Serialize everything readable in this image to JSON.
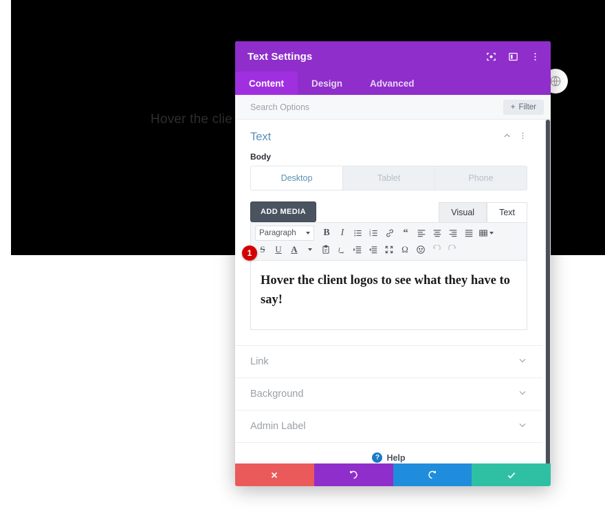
{
  "page_background": {
    "hero_text": "Hover the clie",
    "dark_color": "#000000",
    "globe_button_icon": "globe-icon"
  },
  "modal": {
    "title": "Text Settings",
    "header_icons": [
      {
        "name": "focus-target-icon"
      },
      {
        "name": "layout-panel-icon"
      },
      {
        "name": "more-vertical-icon"
      }
    ],
    "tabs": [
      {
        "label": "Content",
        "active": true
      },
      {
        "label": "Design",
        "active": false
      },
      {
        "label": "Advanced",
        "active": false
      }
    ],
    "search": {
      "placeholder": "Search Options",
      "value": "",
      "filter_label": "Filter"
    },
    "section": {
      "title": "Text",
      "collapse_icon": "chevron-up-icon",
      "menu_icon": "more-vertical-icon"
    },
    "body_field": {
      "label": "Body",
      "device_tabs": [
        {
          "label": "Desktop",
          "active": true
        },
        {
          "label": "Tablet",
          "active": false
        },
        {
          "label": "Phone",
          "active": false
        }
      ],
      "add_media_label": "ADD MEDIA",
      "editor_modes": [
        {
          "label": "Visual",
          "active": false
        },
        {
          "label": "Text",
          "active": true
        }
      ],
      "toolbar_row1": [
        {
          "name": "paragraph-format-select",
          "label": "Paragraph",
          "type": "select"
        },
        {
          "name": "bold-icon",
          "glyph": "B",
          "type": "bold"
        },
        {
          "name": "italic-icon",
          "glyph": "I",
          "type": "italic"
        },
        {
          "name": "bullet-list-icon",
          "type": "ul"
        },
        {
          "name": "numbered-list-icon",
          "type": "ol"
        },
        {
          "name": "link-icon",
          "type": "link"
        },
        {
          "name": "blockquote-icon",
          "glyph": "“",
          "type": "quote"
        },
        {
          "name": "align-left-icon",
          "type": "align-left"
        },
        {
          "name": "align-center-icon",
          "type": "align-center"
        },
        {
          "name": "align-right-icon",
          "type": "align-right"
        },
        {
          "name": "align-justify-icon",
          "type": "align-justify"
        },
        {
          "name": "table-icon",
          "type": "table"
        }
      ],
      "toolbar_row2": [
        {
          "name": "strikethrough-icon",
          "glyph": "S",
          "type": "strike"
        },
        {
          "name": "underline-icon",
          "glyph": "U",
          "type": "underline"
        },
        {
          "name": "text-color-icon",
          "glyph": "A",
          "type": "textcolor"
        },
        {
          "name": "paste-as-text-icon",
          "type": "paste"
        },
        {
          "name": "clear-formatting-icon",
          "glyph": "I",
          "type": "clearfmt"
        },
        {
          "name": "indent-icon",
          "type": "indent"
        },
        {
          "name": "outdent-icon",
          "type": "outdent"
        },
        {
          "name": "fullscreen-icon",
          "type": "fullscreen"
        },
        {
          "name": "special-character-icon",
          "glyph": "Ω",
          "type": "omega"
        },
        {
          "name": "emoji-icon",
          "type": "emoji"
        },
        {
          "name": "undo-icon",
          "type": "undo",
          "disabled": true
        },
        {
          "name": "redo-icon",
          "type": "redo",
          "disabled": true
        }
      ],
      "content_text": "Hover the client logos to see what they have to say!"
    },
    "accordions": [
      {
        "label": "Link"
      },
      {
        "label": "Background"
      },
      {
        "label": "Admin Label"
      }
    ],
    "help": {
      "label": "Help",
      "icon_glyph": "?"
    },
    "footer_buttons": [
      {
        "name": "close-button",
        "icon": "close-icon",
        "color": "#eb5a5a"
      },
      {
        "name": "undo-button",
        "icon": "undo-icon",
        "color": "#8f2ecb"
      },
      {
        "name": "redo-button",
        "icon": "redo-icon",
        "color": "#1f8ddb"
      },
      {
        "name": "save-button",
        "icon": "check-icon",
        "color": "#2fc0a4"
      }
    ]
  },
  "annotation": {
    "step_number": "1"
  }
}
